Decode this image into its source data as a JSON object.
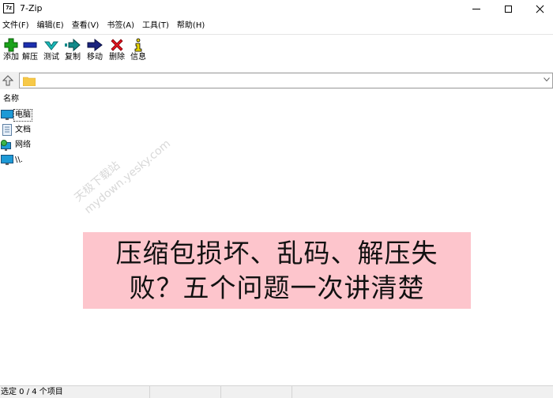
{
  "window": {
    "title": "7-Zip",
    "app_icon_text": "7z"
  },
  "menu": [
    {
      "label": "文件(F)"
    },
    {
      "label": "编辑(E)"
    },
    {
      "label": "查看(V)"
    },
    {
      "label": "书签(A)"
    },
    {
      "label": "工具(T)"
    },
    {
      "label": "帮助(H)"
    }
  ],
  "toolbar": {
    "add": {
      "label": "添加",
      "icon": "add-icon",
      "color": "#1aa31a"
    },
    "extract": {
      "label": "解压",
      "icon": "extract-icon",
      "color": "#1c2fb0"
    },
    "test": {
      "label": "测试",
      "icon": "test-icon",
      "color": "#19b8b8"
    },
    "copy": {
      "label": "复制",
      "icon": "copy-icon",
      "color": "#128a8a"
    },
    "move": {
      "label": "移动",
      "icon": "move-icon",
      "color": "#1a237e"
    },
    "delete": {
      "label": "删除",
      "icon": "delete-icon",
      "color": "#e0141e"
    },
    "info": {
      "label": "信息",
      "icon": "info-icon",
      "color": "#e8d400"
    }
  },
  "address": {
    "value": "",
    "placeholder": ""
  },
  "list": {
    "column_name": "名称",
    "items": [
      {
        "label": "电脑",
        "icon": "computer-icon"
      },
      {
        "label": "文档",
        "icon": "documents-icon"
      },
      {
        "label": "网络",
        "icon": "network-icon"
      },
      {
        "label": "\\\\.",
        "icon": "computer-icon"
      }
    ]
  },
  "watermark": {
    "line1": "天极下载站",
    "line2": "mydown.yesky.com"
  },
  "banner": {
    "line1": "压缩包损坏、乱码、解压失",
    "line2": "败？五个问题一次讲清楚",
    "background": "#fdc5cc"
  },
  "status": {
    "selection": "选定 0 / 4 个项目"
  }
}
